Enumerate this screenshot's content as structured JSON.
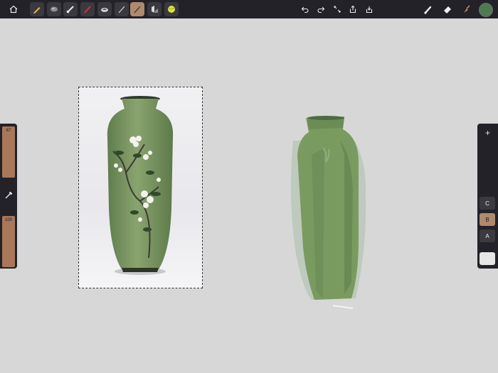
{
  "app": {
    "title": ""
  },
  "toolbar": {
    "left": [
      {
        "name": "home-icon"
      },
      {
        "name": "pencil-tool-icon"
      },
      {
        "name": "smudge-tool-icon"
      },
      {
        "name": "brush-tool-icon"
      },
      {
        "name": "red-pen-tool-icon"
      },
      {
        "name": "stamp-tool-icon"
      },
      {
        "name": "fine-brush-tool-icon"
      },
      {
        "name": "selected-brush-tool-icon"
      },
      {
        "name": "fill-tool-icon"
      },
      {
        "name": "ball-tool-icon"
      }
    ],
    "center": [
      {
        "name": "undo-icon"
      },
      {
        "name": "redo-icon"
      },
      {
        "name": "transform-icon"
      },
      {
        "name": "share-icon"
      },
      {
        "name": "export-icon"
      }
    ],
    "right": [
      {
        "name": "paint-brush-icon"
      },
      {
        "name": "eraser-icon"
      },
      {
        "name": "smudge-icon"
      },
      {
        "name": "color-swatch-icon"
      }
    ]
  },
  "left_panel": {
    "size_value": "67",
    "opacity_value": "100"
  },
  "right_panel": {
    "add_label": "+",
    "layers": [
      {
        "label": "C",
        "selected": false
      },
      {
        "label": "B",
        "selected": true
      },
      {
        "label": "A",
        "selected": false
      }
    ]
  },
  "colors": {
    "active_color": "#4f7a50",
    "slider_fill": "#a9785a",
    "accent": "#b08a6c"
  }
}
